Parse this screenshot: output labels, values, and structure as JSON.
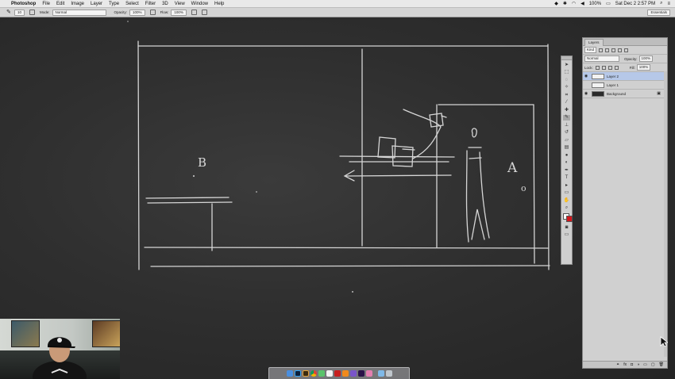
{
  "menubar": {
    "apple": "",
    "app_name": "Photoshop",
    "items": [
      "File",
      "Edit",
      "Image",
      "Layer",
      "Type",
      "Select",
      "Filter",
      "3D",
      "View",
      "Window",
      "Help"
    ],
    "battery": "100%",
    "clock": "Sat Dec 2  2:57 PM"
  },
  "options_bar": {
    "brush_size": "10",
    "mode_label": "Mode:",
    "mode_value": "Normal",
    "opacity_label": "Opacity:",
    "opacity_value": "100%",
    "flow_label": "Flow:",
    "flow_value": "100%",
    "workspace": "Essentials"
  },
  "tools": [
    "move",
    "marquee",
    "lasso",
    "quick-select",
    "crop",
    "eyedropper",
    "healing",
    "brush",
    "stamp",
    "history-brush",
    "eraser",
    "gradient",
    "blur",
    "dodge",
    "pen",
    "type",
    "path-select",
    "shape",
    "hand",
    "zoom",
    "colors",
    "mask",
    "screen-mode"
  ],
  "layers_panel": {
    "tab": "Layers",
    "filter_kind": "Kind",
    "blend_mode": "Normal",
    "opacity_label": "Opacity:",
    "opacity_value": "100%",
    "lock_label": "Lock:",
    "fill_label": "Fill:",
    "fill_value": "100%",
    "layers": [
      {
        "name": "Layer 2",
        "selected": true,
        "thumb": "light"
      },
      {
        "name": "Layer 1",
        "selected": false,
        "thumb": "light"
      },
      {
        "name": "Background",
        "selected": false,
        "thumb": "dark",
        "locked": true
      }
    ]
  },
  "sketch": {
    "label_b": "B",
    "label_a": "A",
    "label_o": "0",
    "label_o2": "o"
  },
  "colors": {
    "chalkboard": "#2f2f2f",
    "chalk": "#e6e6e6",
    "selected_layer": "#b6c8e8",
    "background_swatch": "#d4161c"
  },
  "dock_apps": [
    "finder",
    "photoshop",
    "bridge",
    "chrome",
    "messages",
    "calendar",
    "acrobat",
    "vlc",
    "powerpoint",
    "premiere",
    "photos",
    "trash"
  ]
}
